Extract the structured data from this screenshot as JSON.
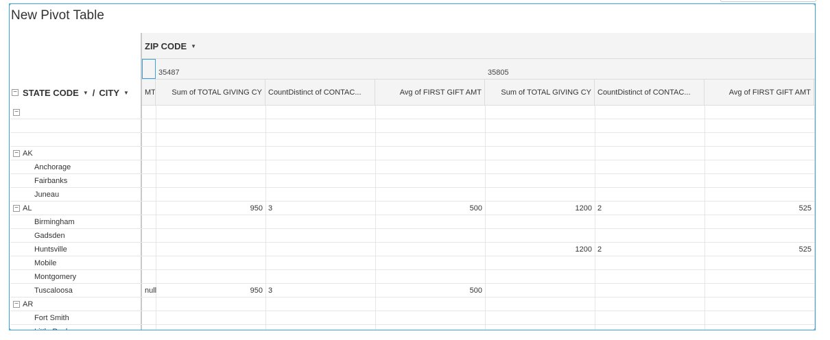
{
  "title": "New Pivot Table",
  "column_field": {
    "label": "ZIP CODE"
  },
  "row_field": {
    "label1": "STATE CODE",
    "separator": "/",
    "label2": "CITY"
  },
  "zip_values": [
    "35487",
    "35805"
  ],
  "partial_header": "MT",
  "measure_headers": [
    "Sum of TOTAL GIVING CY",
    "CountDistinct of CONTAC...",
    "Avg of FIRST GIFT AMT"
  ],
  "rows": [
    {
      "type": "group",
      "label": "",
      "vals": [
        "",
        "",
        "",
        "",
        "",
        "",
        ""
      ]
    },
    {
      "type": "blank",
      "label": "",
      "vals": [
        "",
        "",
        "",
        "",
        "",
        "",
        ""
      ]
    },
    {
      "type": "blank",
      "label": "",
      "vals": [
        "",
        "",
        "",
        "",
        "",
        "",
        ""
      ]
    },
    {
      "type": "group",
      "label": "AK",
      "vals": [
        "",
        "",
        "",
        "",
        "",
        "",
        ""
      ]
    },
    {
      "type": "child",
      "label": "Anchorage",
      "vals": [
        "",
        "",
        "",
        "",
        "",
        "",
        ""
      ]
    },
    {
      "type": "child",
      "label": "Fairbanks",
      "vals": [
        "",
        "",
        "",
        "",
        "",
        "",
        ""
      ]
    },
    {
      "type": "child",
      "label": "Juneau",
      "vals": [
        "",
        "",
        "",
        "",
        "",
        "",
        ""
      ]
    },
    {
      "type": "group",
      "label": "AL",
      "vals": [
        "",
        "950",
        "3",
        "500",
        "1200",
        "2",
        "525"
      ]
    },
    {
      "type": "child",
      "label": "Birmingham",
      "vals": [
        "",
        "",
        "",
        "",
        "",
        "",
        ""
      ]
    },
    {
      "type": "child",
      "label": "Gadsden",
      "vals": [
        "",
        "",
        "",
        "",
        "",
        "",
        ""
      ]
    },
    {
      "type": "child",
      "label": "Huntsville",
      "vals": [
        "",
        "",
        "",
        "",
        "1200",
        "2",
        "525"
      ]
    },
    {
      "type": "child",
      "label": "Mobile",
      "vals": [
        "",
        "",
        "",
        "",
        "",
        "",
        ""
      ]
    },
    {
      "type": "child",
      "label": "Montgomery",
      "vals": [
        "",
        "",
        "",
        "",
        "",
        "",
        ""
      ]
    },
    {
      "type": "child",
      "label": "Tuscaloosa",
      "vals": [
        "null",
        "950",
        "3",
        "500",
        "",
        "",
        ""
      ]
    },
    {
      "type": "group",
      "label": "AR",
      "vals": [
        "",
        "",
        "",
        "",
        "",
        "",
        ""
      ]
    },
    {
      "type": "child",
      "label": "Fort Smith",
      "vals": [
        "",
        "",
        "",
        "",
        "",
        "",
        ""
      ]
    },
    {
      "type": "child",
      "label": "Little Rock",
      "vals": [
        "",
        "",
        "",
        "",
        "",
        "",
        ""
      ]
    }
  ],
  "colors": {
    "selection": "#3aa0d8",
    "header_bg": "#f4f4f4",
    "grid": "#e6e6e6"
  }
}
